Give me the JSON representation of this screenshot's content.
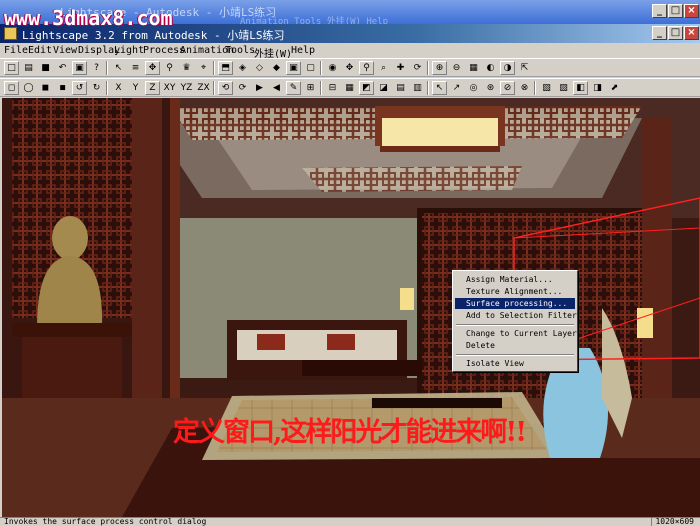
{
  "watermark": "www.3dmax8.com",
  "ghost_window": {
    "title": "Lightscape - Autodesk - 小靖LS练习",
    "menu_hint": "Animation  Tools  外挂(W)  Help"
  },
  "window": {
    "title": "Lightscape 3.2 from Autodesk - 小靖LS练习",
    "caption_buttons": [
      "_",
      "□",
      "×"
    ]
  },
  "menu": [
    "File",
    "Edit",
    "View",
    "Display",
    "Light",
    "Process",
    "Animation",
    "Tools",
    "外挂(W)",
    "Help"
  ],
  "toolbar1_glyphs": [
    "□",
    "▤",
    "■",
    "↶",
    "▣",
    "?",
    "↖",
    "≡",
    "✥",
    "⚲",
    "♛",
    "⌖",
    "⬒",
    "◈",
    "◇",
    "◆",
    "▣",
    "▢",
    "◉",
    "✥",
    "⚲",
    "⌕",
    "✚",
    "⟳",
    "⊕",
    "⊖",
    "▦",
    "◐",
    "◑",
    "⇱"
  ],
  "toolbar2_glyphs": [
    "◻",
    "◯",
    "◼",
    "◾",
    "↺",
    "↻",
    "X",
    "Y",
    "Z",
    "XY",
    "YZ",
    "ZX",
    "⟲",
    "⟳",
    "▶",
    "◀",
    "✎",
    "⊞",
    "⊟",
    "▦",
    "◩",
    "◪",
    "▤",
    "▥",
    "↖",
    "↗",
    "◎",
    "⊛",
    "⊘",
    "⊗",
    "▧",
    "▨",
    "◧",
    "◨",
    "⬈"
  ],
  "context_menu": {
    "items": [
      {
        "label": "Assign Material...",
        "selected": false
      },
      {
        "label": "Texture Alignment...",
        "selected": false
      },
      {
        "label": "Surface processing...",
        "selected": true
      },
      {
        "label": "Add to Selection Filter",
        "selected": false
      },
      {
        "label": "---"
      },
      {
        "label": "Change to Current Layer",
        "selected": false
      },
      {
        "label": "Delete",
        "selected": false
      },
      {
        "label": "---"
      },
      {
        "label": "Isolate View",
        "selected": false
      }
    ]
  },
  "overlay_caption": "定义窗口,这样阳光才能进来啊!!",
  "status": {
    "text": "Invokes the surface process control dialog",
    "size": "1020×609"
  },
  "colors": {
    "title_active": "#0a246a",
    "menu_highlight": "#0a246a",
    "caption_red": "#ff1a1a",
    "wood": "#5a1e14",
    "selection_red": "#ff2020"
  }
}
